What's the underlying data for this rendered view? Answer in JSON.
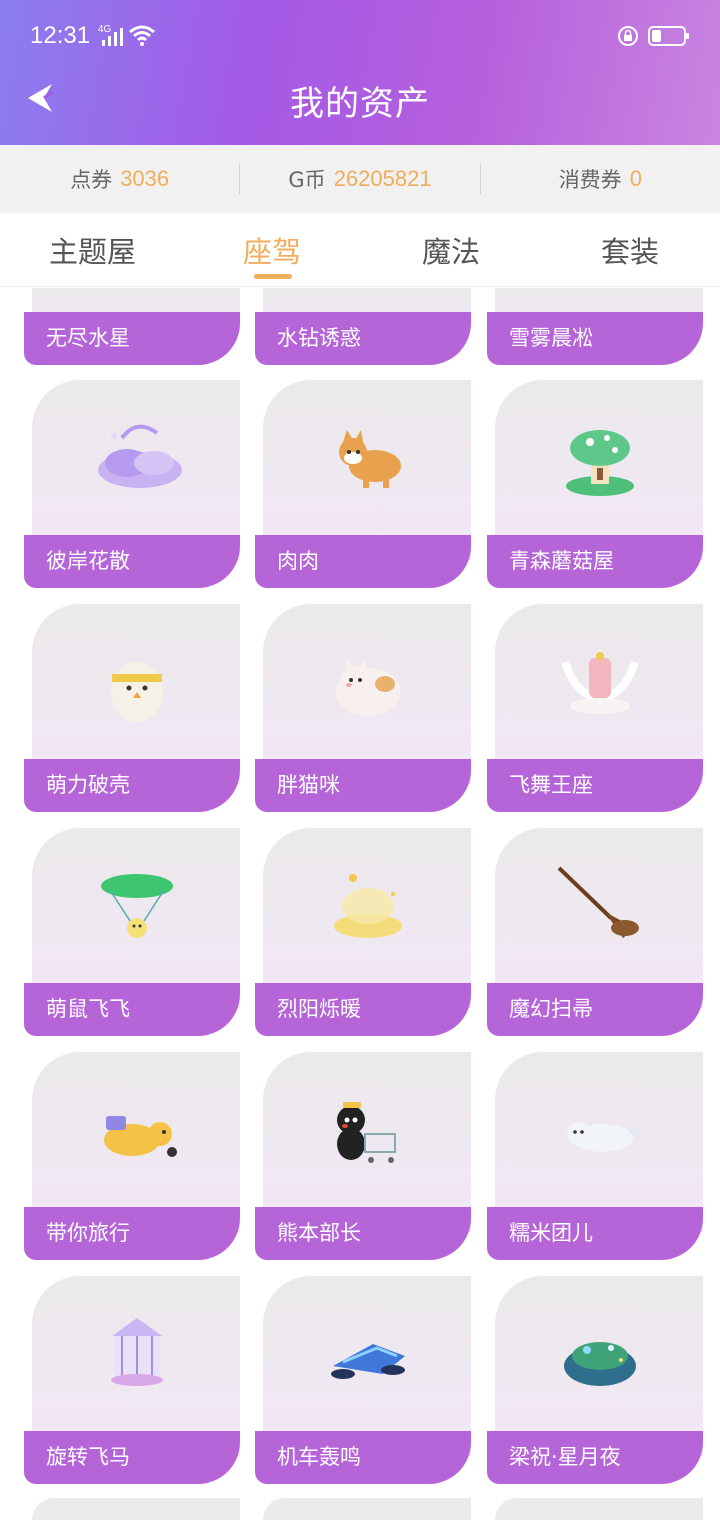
{
  "status": {
    "time": "12:31",
    "network": "4G"
  },
  "header": {
    "title": "我的资产"
  },
  "balances": [
    {
      "label": "点券",
      "value": "3036"
    },
    {
      "label": "G币",
      "value": "26205821"
    },
    {
      "label": "消费券",
      "value": "0"
    }
  ],
  "tabs": [
    {
      "label": "主题屋"
    },
    {
      "label": "座驾"
    },
    {
      "label": "魔法"
    },
    {
      "label": "套装"
    }
  ],
  "active_tab": "座驾",
  "items_partial": [
    {
      "name": "无尽水星"
    },
    {
      "name": "水钻诱惑"
    },
    {
      "name": "雪雾晨凇"
    }
  ],
  "items": [
    {
      "name": "彼岸花散",
      "icon": "purple-cloud-icon"
    },
    {
      "name": "肉肉",
      "icon": "corgi-dog-icon"
    },
    {
      "name": "青森蘑菇屋",
      "icon": "mushroom-house-icon"
    },
    {
      "name": "萌力破壳",
      "icon": "hatching-egg-icon"
    },
    {
      "name": "胖猫咪",
      "icon": "fat-cat-icon"
    },
    {
      "name": "飞舞王座",
      "icon": "winged-throne-icon"
    },
    {
      "name": "萌鼠飞飞",
      "icon": "leaf-parachute-mouse-icon"
    },
    {
      "name": "烈阳烁暖",
      "icon": "golden-cloud-icon"
    },
    {
      "name": "魔幻扫帚",
      "icon": "magic-broom-icon"
    },
    {
      "name": "带你旅行",
      "icon": "travel-dog-icon"
    },
    {
      "name": "熊本部长",
      "icon": "kumamon-cart-icon"
    },
    {
      "name": "糯米团儿",
      "icon": "white-seal-icon"
    },
    {
      "name": "旋转飞马",
      "icon": "carousel-icon"
    },
    {
      "name": "机车轰鸣",
      "icon": "blue-motorbike-icon"
    },
    {
      "name": "梁祝·星月夜",
      "icon": "starry-night-island-icon"
    }
  ],
  "colors": {
    "accent": "#f0ad5b",
    "card_label": "#b665d8",
    "header_start": "#8b7ef0",
    "header_end": "#c985e0"
  }
}
